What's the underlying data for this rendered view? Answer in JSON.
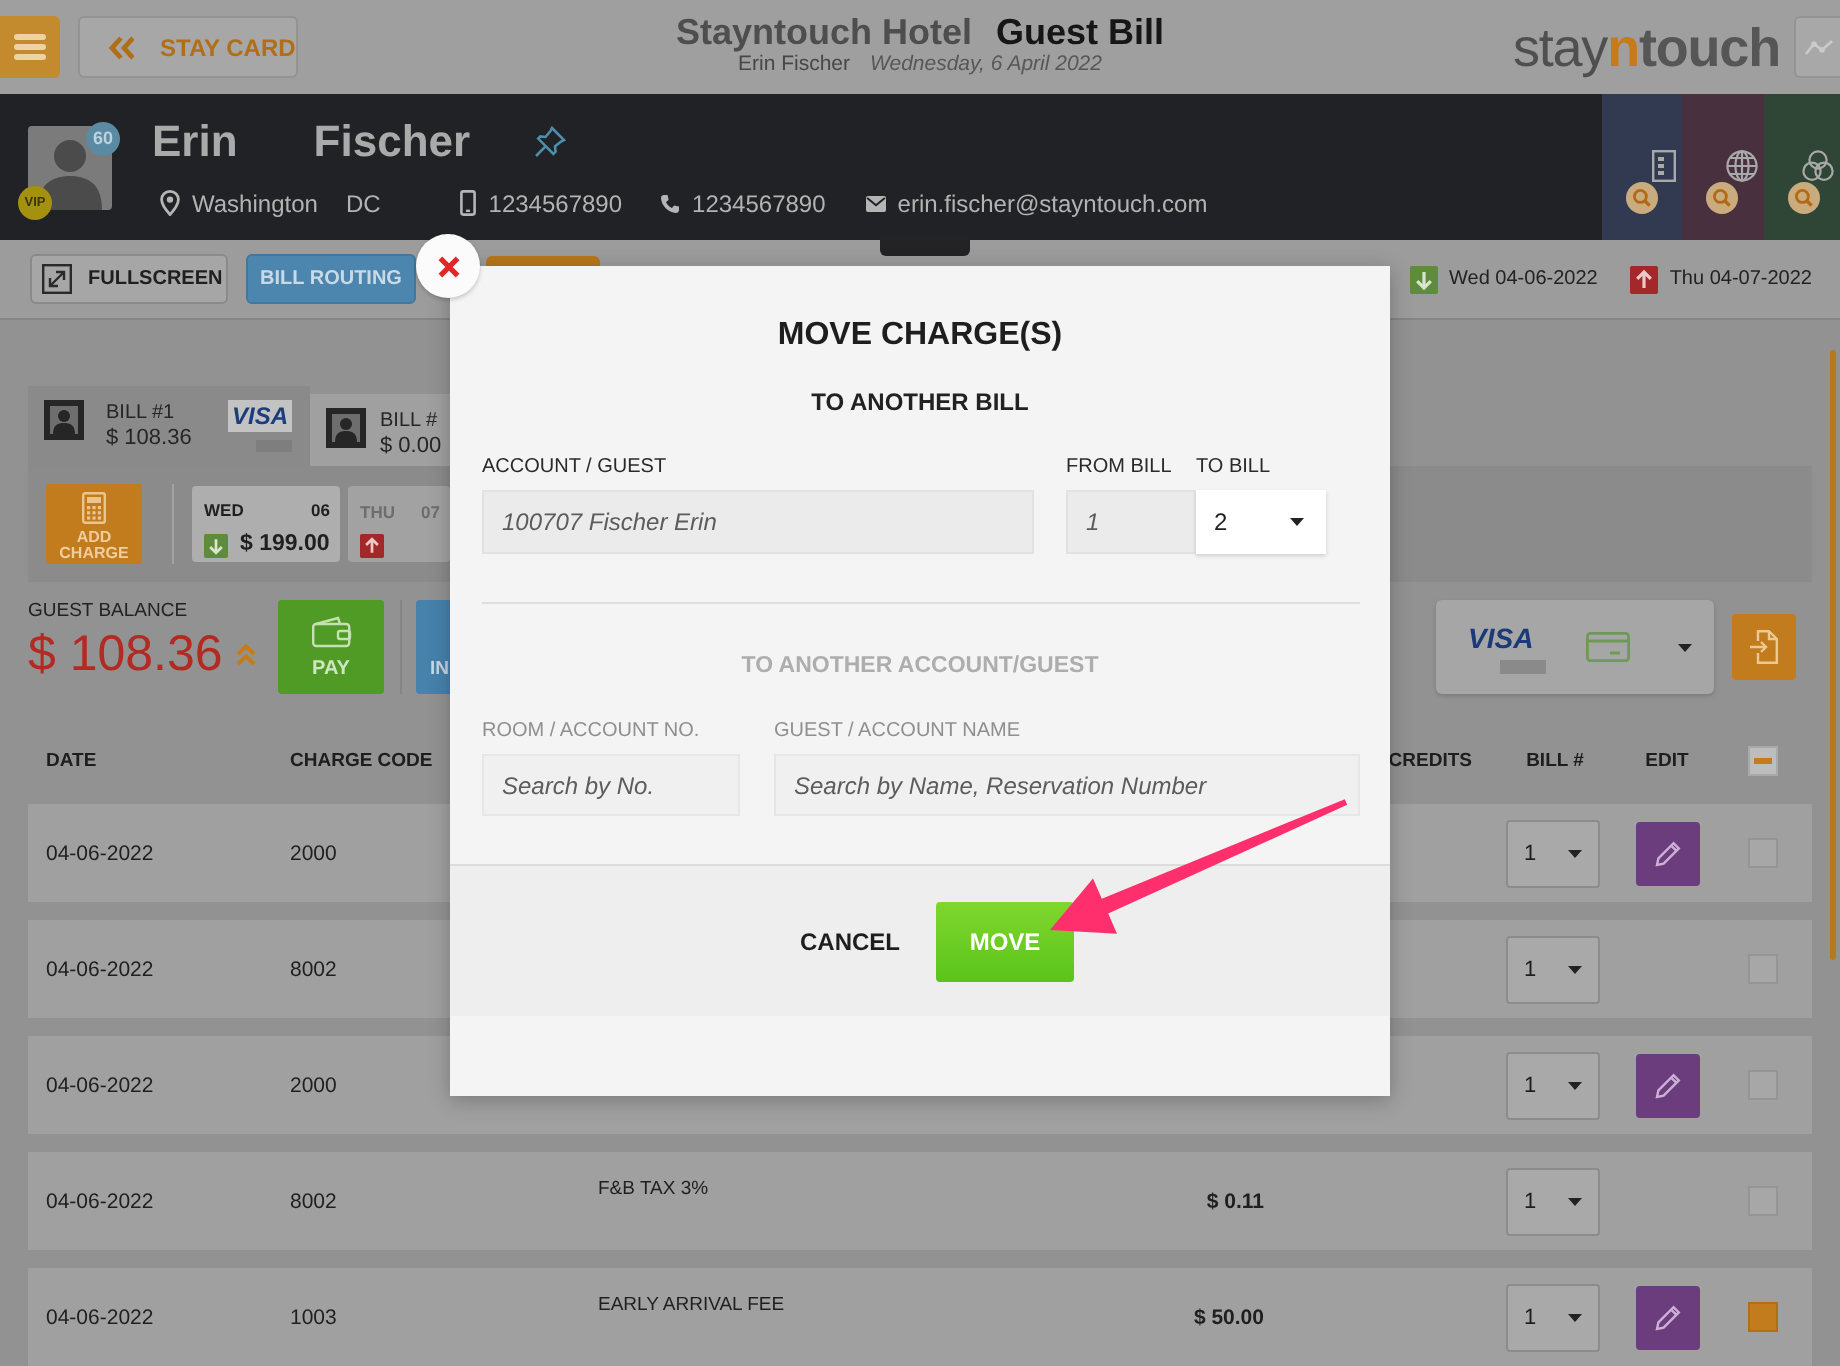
{
  "header": {
    "back_button": "STAY CARD",
    "hotel": "Stayntouch Hotel",
    "title": "Guest Bill",
    "guest_name": "Erin Fischer",
    "date": "Wednesday, 6 April 2022",
    "logo": {
      "light": "stay",
      "accent": "n",
      "bold": "touch"
    }
  },
  "guest": {
    "first_name": "Erin",
    "last_name": "Fischer",
    "points": "60",
    "vip": "VIP",
    "city": "Washington",
    "state": "DC",
    "mobile": "1234567890",
    "phone": "1234567890",
    "email": "erin.fischer@stayntouch.com",
    "tiles": [
      {
        "kind": "building",
        "color": "#323a52"
      },
      {
        "kind": "globe",
        "color": "#48303f"
      },
      {
        "kind": "circles",
        "color": "#2f4636"
      }
    ]
  },
  "toolbar": {
    "buttons": [
      {
        "kind": "fullscreen",
        "label": "FULLSCREEN"
      },
      {
        "kind": "routing",
        "label": "BILL ROUTING"
      },
      {
        "kind": "action"
      }
    ],
    "dates": [
      {
        "kind": "arrival",
        "label": "Wed 04-06-2022"
      },
      {
        "kind": "departure",
        "label": "Thu 04-07-2022"
      }
    ]
  },
  "bills": [
    {
      "label": "BILL #1",
      "amount": "$ 108.36",
      "card": "VISA",
      "selected": true
    },
    {
      "label": "BILL #",
      "amount": "$ 0.00",
      "selected": false
    }
  ],
  "add_charge": "ADD CHARGE",
  "days": [
    {
      "day": "WED",
      "date": "06",
      "kind": "arrival",
      "amount": "$ 199.00",
      "selected": true
    },
    {
      "day": "THU",
      "date": "07",
      "kind": "departure",
      "selected": false
    }
  ],
  "balance": {
    "label": "GUEST BALANCE",
    "amount": "$ 108.36"
  },
  "actions": [
    {
      "kind": "pay",
      "label": "PAY"
    },
    {
      "kind": "invoice",
      "label": "IN"
    }
  ],
  "payment": {
    "card": "VISA"
  },
  "table": {
    "columns": [
      "DATE",
      "CHARGE CODE",
      "CREDITS",
      "BILL #",
      "EDIT"
    ],
    "indeterminate": true,
    "rows": [
      {
        "date": "04-06-2022",
        "code": "2000",
        "bill": "1",
        "editable": true,
        "checked": false
      },
      {
        "date": "04-06-2022",
        "code": "8002",
        "bill": "1",
        "editable": false,
        "checked": false
      },
      {
        "date": "04-06-2022",
        "code": "2000",
        "bill": "1",
        "editable": true,
        "checked": false
      },
      {
        "date": "04-06-2022",
        "code": "8002",
        "description": "F&B TAX 3%",
        "amount": "$ 0.11",
        "bill": "1",
        "editable": false,
        "checked": false
      },
      {
        "date": "04-06-2022",
        "code": "1003",
        "description": "EARLY ARRIVAL FEE",
        "amount": "$ 50.00",
        "bill": "1",
        "editable": true,
        "checked": true
      }
    ]
  },
  "modal": {
    "title": "MOVE CHARGE(S)",
    "to_bill": {
      "heading": "TO ANOTHER BILL",
      "account_label": "ACCOUNT / GUEST",
      "account_value": "100707 Fischer Erin",
      "from_label": "FROM BILL",
      "from_value": "1",
      "to_label": "TO BILL",
      "to_value": "2"
    },
    "to_account": {
      "heading": "TO ANOTHER ACCOUNT/GUEST",
      "disabled": true,
      "room_label": "ROOM / ACCOUNT NO.",
      "room_placeholder": "Search by No.",
      "name_label": "GUEST / ACCOUNT NAME",
      "name_placeholder": "Search by Name, Reservation Number"
    },
    "buttons": [
      {
        "kind": "text",
        "label": "CANCEL"
      },
      {
        "kind": "primary",
        "label": "MOVE"
      }
    ]
  }
}
